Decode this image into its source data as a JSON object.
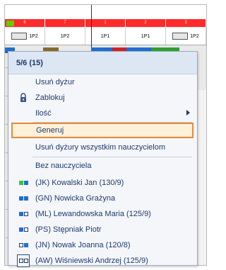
{
  "grid": {
    "head_numbers": [
      "6",
      "7",
      "1",
      "2",
      "3"
    ],
    "cells": [
      "1P2",
      "1P2",
      "1P1",
      "1P1",
      "1P2"
    ]
  },
  "menu": {
    "title": "5/6 (15)",
    "items": [
      {
        "label": "Usuń dyżur"
      },
      {
        "label": "Zablokuj",
        "icon": "lock-icon"
      },
      {
        "label": "Ilość",
        "submenu": true
      },
      {
        "label": "Generuj",
        "highlighted": true
      },
      {
        "label": "Usuń dyżury wszystkim nauczycielom"
      },
      {
        "label": "Bez nauczyciela"
      },
      {
        "label": "(JK) Kowalski Jan (130/9)",
        "squares": [
          "green",
          "blue"
        ]
      },
      {
        "label": "(GN) Nowicka Grażyna",
        "squares": [
          "blue",
          "blue"
        ]
      },
      {
        "label": "(ML) Lewandowska Maria (125/9)",
        "squares": [
          "blue",
          "white"
        ]
      },
      {
        "label": "(PS) Stępniak Piotr",
        "squares": [
          "blue",
          "white"
        ]
      },
      {
        "label": "(JN) Nowak Joanna (120/8)",
        "squares": [
          "white",
          "blue"
        ]
      },
      {
        "label": "(AW) Wiśniewski Andrzej (125/9)",
        "squares": [
          "white",
          "white"
        ],
        "framed": true
      }
    ]
  },
  "colors": {
    "accent_red": "#ff2a2a",
    "menu_header_bg": "#dde6f3",
    "menu_text": "#1c3a6e",
    "highlight_border": "#e5893a",
    "highlight_bg": "#fdf1d9",
    "square_blue": "#1f6fcf",
    "square_green": "#2ecc3a"
  }
}
